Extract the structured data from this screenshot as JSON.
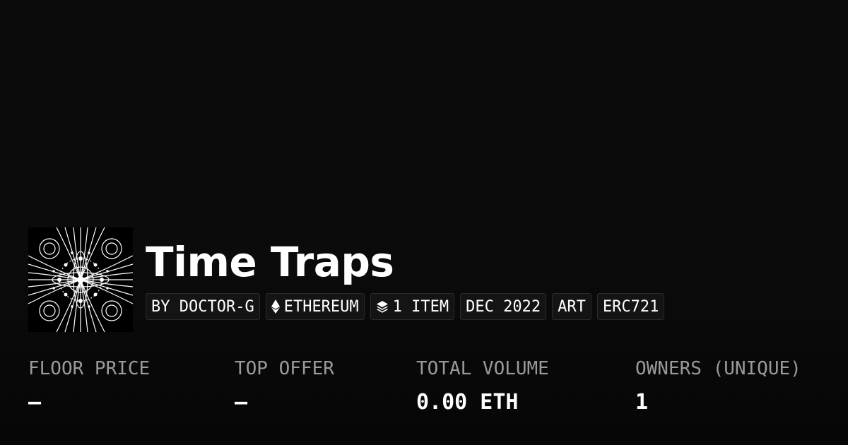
{
  "collection": {
    "title": "Time Traps",
    "thumbnail_icon": "collection-artwork"
  },
  "tags": {
    "creator": "BY DOCTOR-G",
    "chain": "ETHEREUM",
    "chain_icon": "ethereum-icon",
    "items": "1 ITEM",
    "items_icon": "layers-icon",
    "date": "DEC 2022",
    "category": "ART",
    "standard": "ERC721"
  },
  "stats": {
    "floor_price": {
      "label": "FLOOR PRICE",
      "value": "–"
    },
    "top_offer": {
      "label": "TOP OFFER",
      "value": "–"
    },
    "total_volume": {
      "label": "TOTAL VOLUME",
      "value": "0.00 ETH"
    },
    "owners": {
      "label": "OWNERS (UNIQUE)",
      "value": "1"
    }
  },
  "colors": {
    "background": "#0a0a0a",
    "text": "#ffffff",
    "label": "#9a9a9a",
    "tag_bg": "#141414",
    "tag_border": "#2a2a2a"
  }
}
